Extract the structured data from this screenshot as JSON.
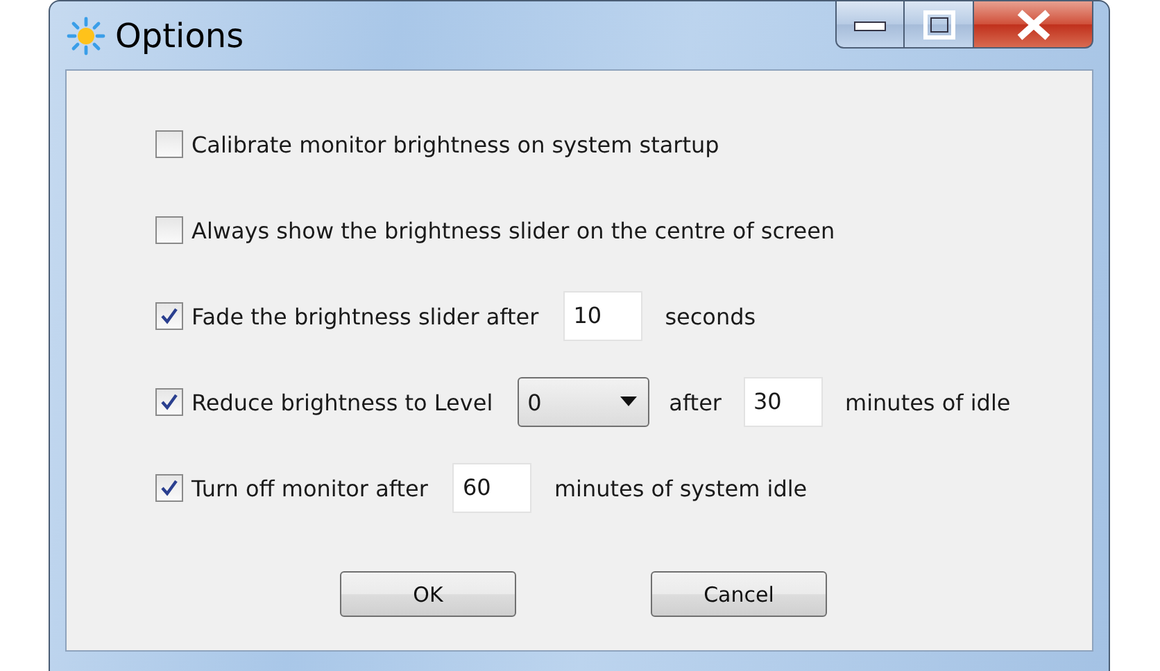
{
  "window": {
    "title": "Options"
  },
  "options": [
    {
      "checked": false,
      "parts": [
        {
          "kind": "text",
          "text": "Calibrate monitor brightness on system startup"
        }
      ]
    },
    {
      "checked": false,
      "parts": [
        {
          "kind": "text",
          "text": "Always show the brightness slider on the centre of screen"
        }
      ]
    },
    {
      "checked": true,
      "parts": [
        {
          "kind": "text",
          "text": "Fade the brightness slider after"
        },
        {
          "kind": "field",
          "value": "10"
        },
        {
          "kind": "text",
          "text": "seconds"
        }
      ]
    },
    {
      "checked": true,
      "parts": [
        {
          "kind": "text",
          "text": "Reduce brightness to Level"
        },
        {
          "kind": "dropdown",
          "value": "0"
        },
        {
          "kind": "text",
          "text": "after"
        },
        {
          "kind": "field",
          "value": "30"
        },
        {
          "kind": "text",
          "text": "minutes of idle"
        }
      ]
    },
    {
      "checked": true,
      "parts": [
        {
          "kind": "text",
          "text": "Turn off monitor after"
        },
        {
          "kind": "field",
          "value": "60"
        },
        {
          "kind": "text",
          "text": "minutes of system idle"
        }
      ]
    }
  ],
  "buttons": [
    "OK",
    "Cancel"
  ]
}
